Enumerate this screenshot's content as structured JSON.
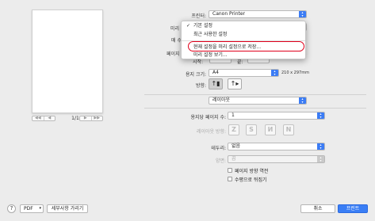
{
  "preview": {
    "page_counter": "1/1",
    "nav_first": "◀◀",
    "nav_prev": "◀",
    "nav_next": "▶",
    "nav_last": "▶▶"
  },
  "printer": {
    "label": "프린터:",
    "value": "Canon Printer"
  },
  "presets": {
    "label": "미리 설정",
    "menu": {
      "items": [
        "기본 설정",
        "최근 사용한 설정",
        "현재 설정을 미리 설정으로 저장...",
        "미리 설정 보기..."
      ],
      "checked_index": 0
    }
  },
  "copies": {
    "label": "매 수",
    "label_visible": "매 수:"
  },
  "pages": {
    "label": "페이지",
    "from_label": "시작:",
    "to_label": "끝:"
  },
  "paper_size": {
    "label": "용지 크기:",
    "value": "A4",
    "dimensions": "210 x 297mm"
  },
  "orientation": {
    "label": "방향:"
  },
  "section": {
    "value": "레이아웃"
  },
  "pages_per_sheet": {
    "label": "용지당 페이지 수:",
    "value": "1"
  },
  "layout_direction": {
    "label": "레이아웃 방향:",
    "buttons": [
      "Z",
      "S",
      "И",
      "N"
    ]
  },
  "border": {
    "label": "테두리:",
    "value": "없음"
  },
  "two_sided": {
    "label": "양면:",
    "value": "끔"
  },
  "options": {
    "reverse_orientation": "페이지 방향 역전",
    "flip_horizontal": "수평으로 뒤집기"
  },
  "footer": {
    "help": "?",
    "pdf": "PDF",
    "hide_details": "세부사항 가리기",
    "cancel": "취소",
    "print": "프린트"
  },
  "colors": {
    "accent": "#3a7ef5",
    "highlight_ring": "#e0001b"
  }
}
